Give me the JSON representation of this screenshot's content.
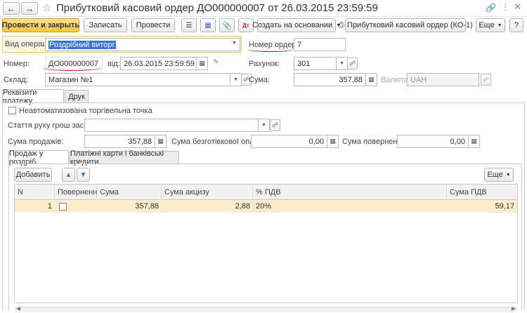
{
  "header": {
    "title": "Прибутковий касовий ордер ДО000000007 от 26.03.2015 23:59:59",
    "back_icon": "arrow-left-icon",
    "forward_icon": "arrow-right-icon",
    "star_icon": "star-icon",
    "link_icon": "link-icon",
    "more_icon": "vertical-dots-icon",
    "close_icon": "close-icon"
  },
  "toolbar": {
    "post_close": "Провести и закрыть",
    "save": "Записать",
    "post": "Провести",
    "create_based": "Создать на основании",
    "print_order": "Прибутковий касовий ордер (КО-1)",
    "more": "Еще",
    "help": "?"
  },
  "form": {
    "operation_label": "Вид операції:",
    "operation_value": "Роздрібний виторг",
    "order_num_label": "Номер ордеру:",
    "order_num_value": "7",
    "number_label": "Номер:",
    "number_value": "ДО000000007",
    "date_label": "від:",
    "date_value": "26.03.2015 23:59:59",
    "account_label": "Рахунок:",
    "account_value": "301",
    "warehouse_label": "Склад:",
    "warehouse_value": "Магазин №1",
    "sum_label": "Сума:",
    "sum_value": "357,88",
    "currency_label": "Валюта:",
    "currency_value": "UAH"
  },
  "tabs": {
    "payment_details": "Реквізити платежу",
    "print": "Друк"
  },
  "payment": {
    "non_auto_label": "Неавтоматизована торгівельна точка",
    "cash_flow_label": "Стаття руху грош засобів:",
    "cash_flow_value": "",
    "sales_sum_label": "Сума продажів:",
    "sales_sum_value": "357,88",
    "cashless_label": "Сума безготівкової оплати:",
    "cashless_value": "0,00",
    "returns_label": "Сума повернення:",
    "returns_value": "0,00"
  },
  "subtabs": {
    "retail_sales": "Продаж у роздріб",
    "cards": "Платіжні карти і банківські кредити"
  },
  "table_toolbar": {
    "add": "Добавить",
    "more": "Еще"
  },
  "table": {
    "columns": [
      "N",
      "Повернення",
      "Сума",
      "Сума акцизу",
      "% ПДВ",
      "Сума ПДВ"
    ],
    "rows": [
      {
        "n": "1",
        "returned": false,
        "sum": "357,88",
        "excise": "2,88",
        "vat_rate": "20%",
        "vat_sum": "59,17"
      }
    ]
  },
  "colors": {
    "primary_button": "#f3c33f",
    "selection": "#3874d8",
    "row_highlight": "#fbeccb",
    "annotation": "#d01010"
  }
}
